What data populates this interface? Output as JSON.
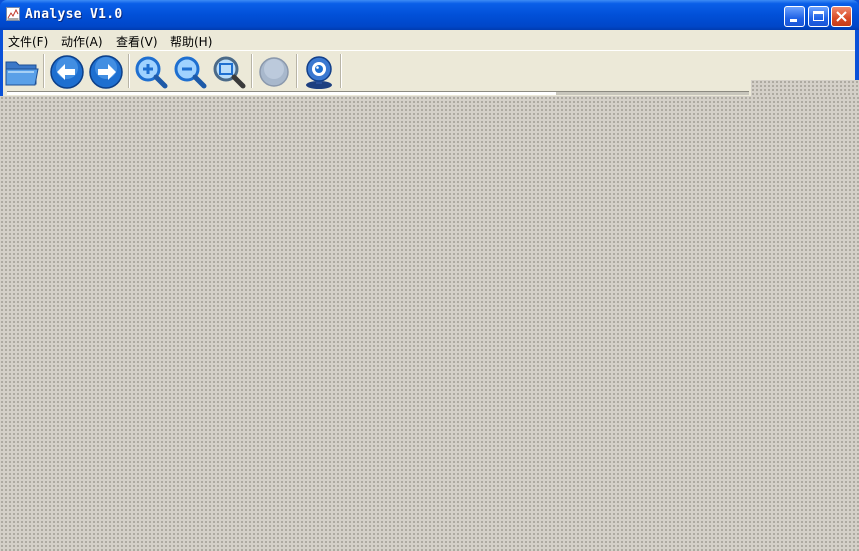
{
  "window": {
    "title": "Analyse V1.0",
    "controls": {
      "minimize": "minimize",
      "maximize": "maximize",
      "close": "close"
    }
  },
  "menu": [
    {
      "label": "文件(F)"
    },
    {
      "label": "动作(A)"
    },
    {
      "label": "查看(V)"
    },
    {
      "label": "帮助(H)"
    }
  ],
  "toolbar": {
    "buttons": [
      {
        "icon": "folder-open-icon"
      },
      {
        "icon": "arrow-left-icon"
      },
      {
        "icon": "arrow-right-icon"
      },
      {
        "icon": "zoom-in-icon"
      },
      {
        "icon": "zoom-out-icon"
      },
      {
        "icon": "zoom-fit-icon"
      },
      {
        "icon": "stop-circle-icon"
      },
      {
        "icon": "webcam-icon"
      }
    ]
  },
  "progress": {
    "value": 0.74
  },
  "colors": {
    "titlebar": "#0150d8",
    "menubar": "#ece9d8",
    "workspace": "#d4d0c8",
    "close_button": "#d84a25",
    "icon_blue": "#1e6fd0"
  }
}
